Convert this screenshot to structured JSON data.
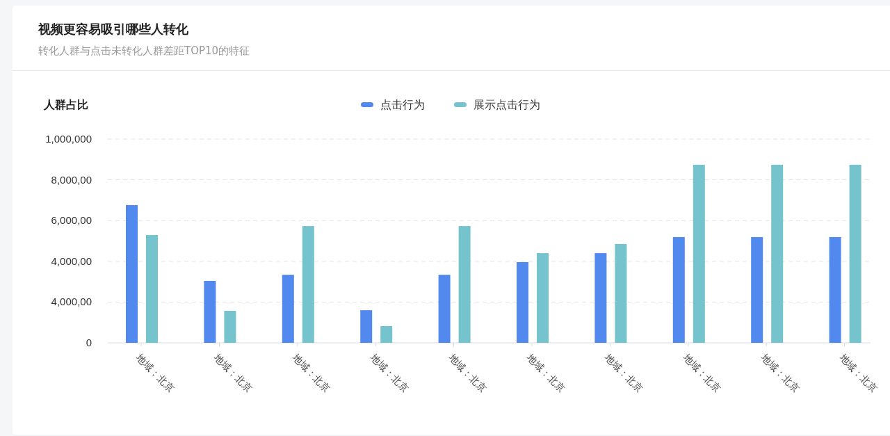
{
  "card": {
    "title": "视频更容易吸引哪些人转化",
    "subtitle": "转化人群与点击未转化人群差距TOP10的特征",
    "chart_data": {
      "type": "bar",
      "ylabel": "人群占比",
      "categories": [
        "地域：北京",
        "地域：北京",
        "地域：北京",
        "地域：北京",
        "地域：北京",
        "地域：北京",
        "地域：北京",
        "地域：北京",
        "地域：北京",
        "地域：北京"
      ],
      "series": [
        {
          "name": "点击行为",
          "color": "#5289ee",
          "values": [
            676000,
            304000,
            334000,
            160000,
            334000,
            396000,
            440000,
            519000,
            519000,
            519000
          ]
        },
        {
          "name": "展示点击行为",
          "color": "#75c3cd",
          "values": [
            529000,
            157000,
            573000,
            82000,
            573000,
            440000,
            485000,
            874000,
            874000,
            874000
          ]
        }
      ],
      "ylim": [
        0,
        1000000
      ],
      "grid": true,
      "legend": "top",
      "yticks": [
        {
          "value": 0,
          "label": "0"
        },
        {
          "value": 200000,
          "label": "4,000,00"
        },
        {
          "value": 400000,
          "label": "4,000,00"
        },
        {
          "value": 600000,
          "label": "6,000,00"
        },
        {
          "value": 800000,
          "label": "8,000,00"
        },
        {
          "value": 1000000,
          "label": "1,000,000"
        }
      ]
    }
  }
}
